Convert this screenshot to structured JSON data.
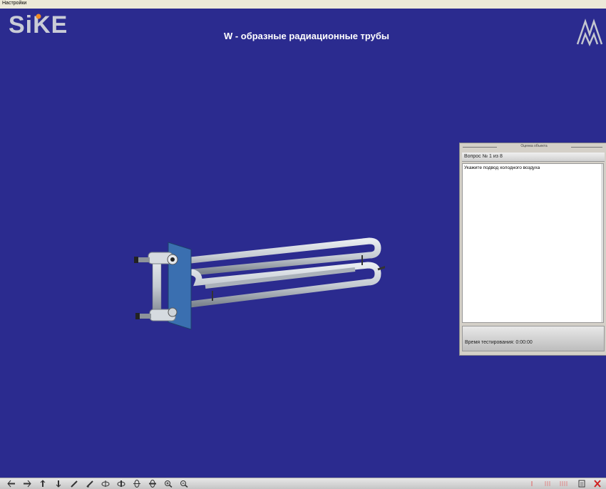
{
  "menu": {
    "settings_label": "Настройки"
  },
  "header": {
    "logo_text": "SiKE",
    "title": "W - образные радиационные трубы",
    "brand_icon": "mk-brand-logo-icon"
  },
  "panel": {
    "header": "Оценка объекта",
    "question_label": "Вопрос №  1 из 8",
    "question_text": "Укажите подвод холодного воздуха",
    "timer_label": "Время тестирования: 0:00:00"
  },
  "colors": {
    "background": "#2b2b8f",
    "tube": "#c5cbd2",
    "flange": "#3a6fb0",
    "close": "#d02020"
  },
  "toolbar": {
    "left_icons": [
      "move-left-icon",
      "move-right-icon",
      "move-up-icon",
      "move-down-icon",
      "diag-up-icon",
      "diag-down-icon",
      "rotate-x-pos-icon",
      "rotate-x-neg-icon",
      "rotate-y-pos-icon",
      "rotate-y-neg-icon",
      "zoom-in-icon",
      "zoom-out-icon"
    ],
    "right_icons": [
      "mark-icon",
      "mark-multi-icon",
      "mark-all-icon",
      "panel-icon",
      "close-icon"
    ]
  }
}
